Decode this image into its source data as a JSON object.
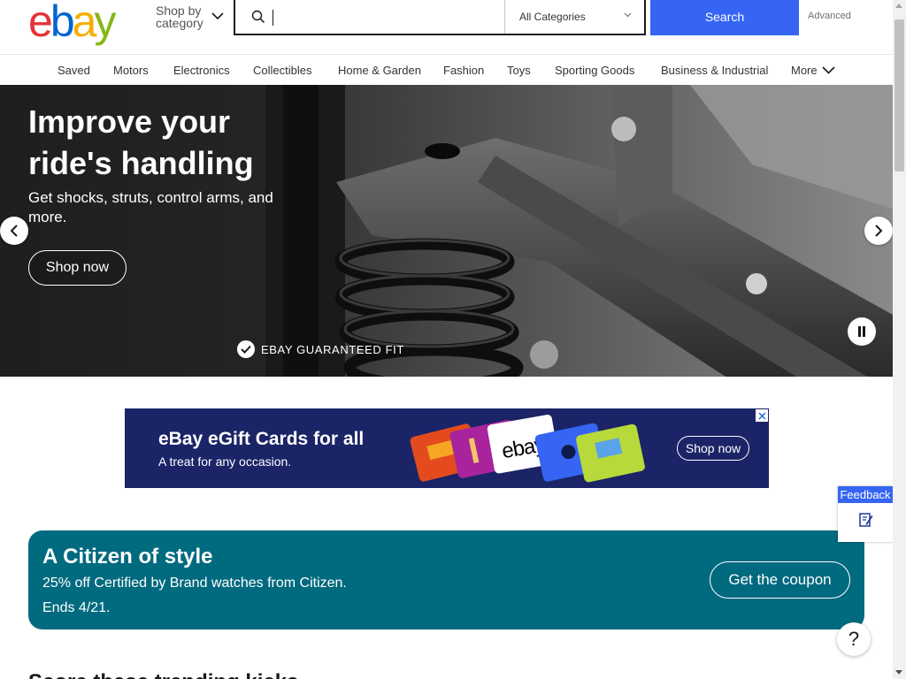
{
  "header": {
    "logo_letters": [
      "e",
      "b",
      "a",
      "y"
    ],
    "logo_colors": [
      "#e53238",
      "#0064d2",
      "#f5af02",
      "#86b817"
    ],
    "shop_by_label": "Shop by category",
    "search": {
      "value": "",
      "placeholder": ""
    },
    "category_select": "All Categories",
    "search_button": "Search",
    "advanced_link": "Advanced"
  },
  "nav": {
    "items": [
      "Saved",
      "Motors",
      "Electronics",
      "Collectibles",
      "Home & Garden",
      "Fashion",
      "Toys",
      "Sporting Goods",
      "Business & Industrial",
      "More"
    ]
  },
  "hero": {
    "title": "Improve your ride's handling",
    "subtitle": "Get shocks, struts, control arms, and more.",
    "cta": "Shop now",
    "badge": "EBAY GUARANTEED FIT"
  },
  "ad": {
    "title": "eBay eGift Cards for all",
    "subtitle": "A treat for any occasion.",
    "card_logo": "ebay",
    "cta": "Shop now"
  },
  "promo": {
    "title": "A Citizen of style",
    "line1": "25% off Certified by Brand watches from Citizen.",
    "line2": "Ends 4/21.",
    "cta": "Get the coupon"
  },
  "next_section": {
    "heading": "Score these trending kicks"
  },
  "feedback": {
    "label": "Feedback"
  },
  "help": {
    "label": "?"
  },
  "colors": {
    "accent": "#3665f3",
    "promo_bg": "#006a7f",
    "ad_bg": "#1a2467"
  }
}
